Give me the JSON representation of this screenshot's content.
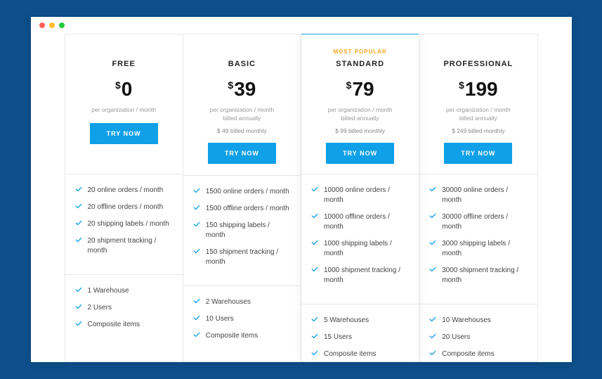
{
  "plans": [
    {
      "badge": "",
      "name": "FREE",
      "price": "0",
      "sub1": "per organization / month",
      "sub2": "",
      "alt": "",
      "cta": "TRY NOW",
      "highlighted": false,
      "featuresA": [
        "20 online orders / month",
        "20 offline orders / month",
        "20 shipping labels / month",
        "20 shipment tracking / month"
      ],
      "featuresB": [
        "1 Warehouse",
        "2 Users",
        "Composite items"
      ]
    },
    {
      "badge": "",
      "name": "BASIC",
      "price": "39",
      "sub1": "per organization / month",
      "sub2": "billed annually",
      "alt": "$ 49 billed monthly",
      "cta": "TRY NOW",
      "highlighted": false,
      "featuresA": [
        "1500 online orders / month",
        "1500 offline orders / month",
        "150 shipping labels / month",
        "150 shipment tracking / month"
      ],
      "featuresB": [
        "2 Warehouses",
        "10 Users",
        "Composite items"
      ]
    },
    {
      "badge": "MOST POPULAR",
      "name": "STANDARD",
      "price": "79",
      "sub1": "per organization / month",
      "sub2": "billed annually",
      "alt": "$ 99 billed monthly",
      "cta": "TRY NOW",
      "highlighted": true,
      "featuresA": [
        "10000 online orders / month",
        "10000 offline orders / month",
        "1000 shipping labels / month",
        "1000 shipment tracking / month"
      ],
      "featuresB": [
        "5 Warehouses",
        "15 Users",
        "Composite items"
      ]
    },
    {
      "badge": "",
      "name": "PROFESSIONAL",
      "price": "199",
      "sub1": "per organization / month",
      "sub2": "billed annually",
      "alt": "$ 249 billed monthly",
      "cta": "TRY NOW",
      "highlighted": false,
      "featuresA": [
        "30000 online orders / month",
        "30000 offline orders / month",
        "3000 shipping labels / month",
        "3000 shipment tracking / month"
      ],
      "featuresB": [
        "10 Warehouses",
        "20 Users",
        "Composite items"
      ]
    }
  ],
  "currency": "$"
}
